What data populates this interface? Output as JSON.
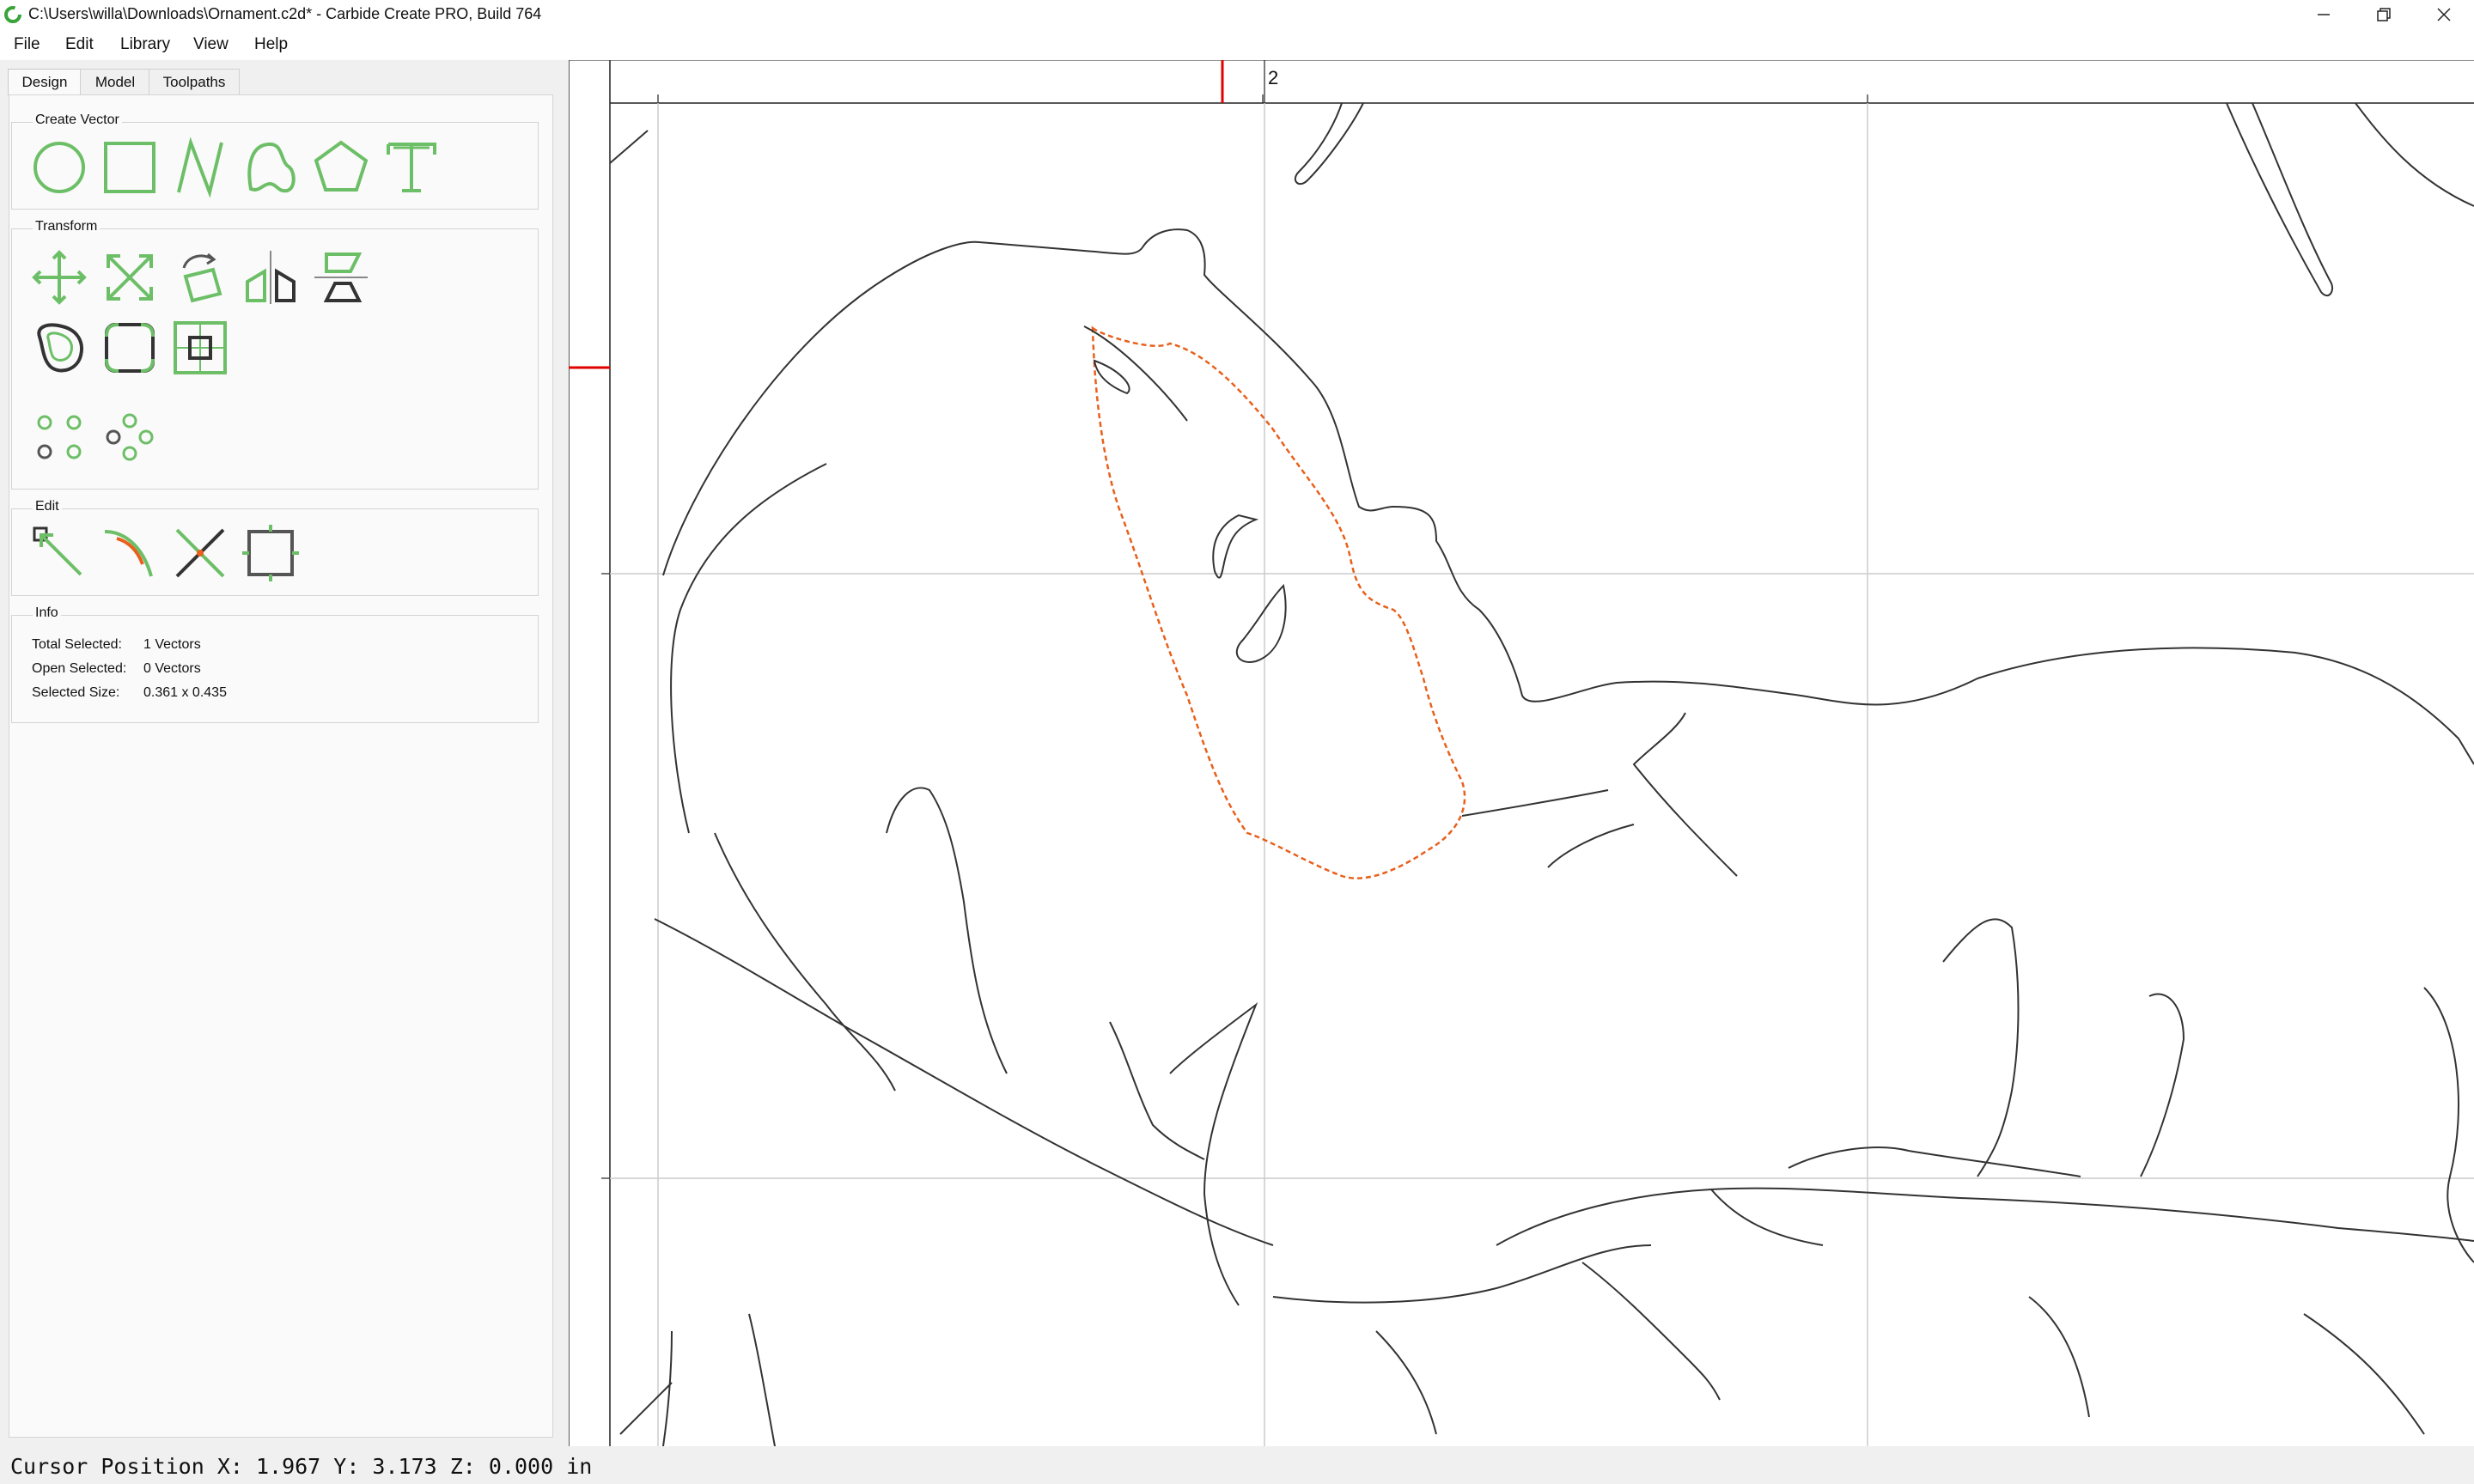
{
  "window": {
    "title": "C:\\Users\\willa\\Downloads\\Ornament.c2d* - Carbide Create PRO, Build 764",
    "app_icon": "carbide-create-icon",
    "controls": [
      "minimize-icon",
      "restore-icon",
      "close-icon"
    ]
  },
  "menu": {
    "file": "File",
    "edit": "Edit",
    "library": "Library",
    "view": "View",
    "help": "Help"
  },
  "tabs": {
    "design": "Design",
    "model": "Model",
    "toolpaths": "Toolpaths",
    "active": "Design"
  },
  "groups": {
    "create_vector": "Create Vector",
    "transform": "Transform",
    "edit": "Edit",
    "info": "Info"
  },
  "tools": {
    "create_vector": [
      "circle-icon",
      "rectangle-icon",
      "polyline-icon",
      "curve-icon",
      "polygon-icon",
      "text-icon"
    ],
    "transform": [
      "move-icon",
      "scale-icon",
      "rotate-icon",
      "mirror-icon",
      "align-icon",
      "offset-icon",
      "fillet-icon",
      "boolean-icon",
      "grid-array-icon",
      "circular-array-icon"
    ],
    "edit": [
      "node-edit-icon",
      "trim-icon",
      "cut-icon",
      "bounding-box-icon"
    ]
  },
  "info": {
    "total_selected_label": "Total Selected:",
    "total_selected_value": "1 Vectors",
    "open_selected_label": "Open Selected:",
    "open_selected_value": "0 Vectors",
    "selected_size_label": "Selected Size:",
    "selected_size_value": "0.361 x 0.435"
  },
  "ruler": {
    "top_label": "2"
  },
  "colors": {
    "accent_green": "#6dbf67",
    "selection_orange": "#e8601c",
    "ruler_marker": "#e00000",
    "grid": "#cccccc"
  },
  "status": {
    "cursor": "Cursor Position X: 1.967 Y: 3.173 Z: 0.000 in"
  }
}
